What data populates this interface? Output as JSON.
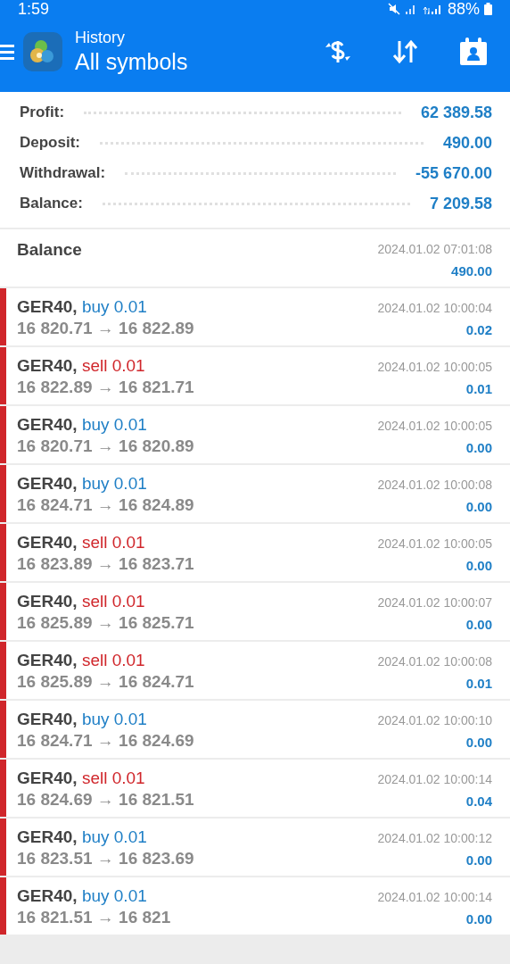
{
  "status_bar": {
    "time": "1:59",
    "battery": "88%"
  },
  "header": {
    "title": "History",
    "subtitle": "All symbols"
  },
  "summary": [
    {
      "label": "Profit:",
      "value": "62 389.58"
    },
    {
      "label": "Deposit:",
      "value": "490.00"
    },
    {
      "label": "Withdrawal:",
      "value": "-55 670.00"
    },
    {
      "label": "Balance:",
      "value": "7 209.58"
    }
  ],
  "balance_entry": {
    "label": "Balance",
    "time": "2024.01.02 07:01:08",
    "amount": "490.00"
  },
  "deals": [
    {
      "symbol": "GER40,",
      "color": "#1f7fc6",
      "order": "buy 0.01",
      "prices": "16 820.71 → 16 822.89",
      "time": "2024.01.02 10:00:04",
      "profit": "0.02"
    },
    {
      "symbol": "GER40,",
      "color": "#d0262b",
      "order": "sell 0.01",
      "prices": "16 822.89 → 16 821.71",
      "time": "2024.01.02 10:00:05",
      "profit": "0.01"
    },
    {
      "symbol": "GER40,",
      "color": "#1f7fc6",
      "order": "buy 0.01",
      "prices": "16 820.71 → 16 820.89",
      "time": "2024.01.02 10:00:05",
      "profit": "0.00"
    },
    {
      "symbol": "GER40,",
      "color": "#1f7fc6",
      "order": "buy 0.01",
      "prices": "16 824.71 → 16 824.89",
      "time": "2024.01.02 10:00:08",
      "profit": "0.00"
    },
    {
      "symbol": "GER40,",
      "color": "#d0262b",
      "order": "sell 0.01",
      "prices": "16 823.89 → 16 823.71",
      "time": "2024.01.02 10:00:05",
      "profit": "0.00"
    },
    {
      "symbol": "GER40,",
      "color": "#d0262b",
      "order": "sell 0.01",
      "prices": "16 825.89 → 16 825.71",
      "time": "2024.01.02 10:00:07",
      "profit": "0.00"
    },
    {
      "symbol": "GER40,",
      "color": "#d0262b",
      "order": "sell 0.01",
      "prices": "16 825.89 → 16 824.71",
      "time": "2024.01.02 10:00:08",
      "profit": "0.01"
    },
    {
      "symbol": "GER40,",
      "color": "#1f7fc6",
      "order": "buy 0.01",
      "prices": "16 824.71 → 16 824.69",
      "time": "2024.01.02 10:00:10",
      "profit": "0.00"
    },
    {
      "symbol": "GER40,",
      "color": "#d0262b",
      "order": "sell 0.01",
      "prices": "16 824.69 → 16 821.51",
      "time": "2024.01.02 10:00:14",
      "profit": "0.04"
    },
    {
      "symbol": "GER40,",
      "color": "#1f7fc6",
      "order": "buy 0.01",
      "prices": "16 823.51 → 16 823.69",
      "time": "2024.01.02 10:00:12",
      "profit": "0.00"
    },
    {
      "symbol": "GER40,",
      "color": "#1f7fc6",
      "order": "buy 0.01",
      "prices": "16 821.51 → 16 821",
      "time": "2024.01.02 10:00:14",
      "profit": "0.00"
    }
  ]
}
